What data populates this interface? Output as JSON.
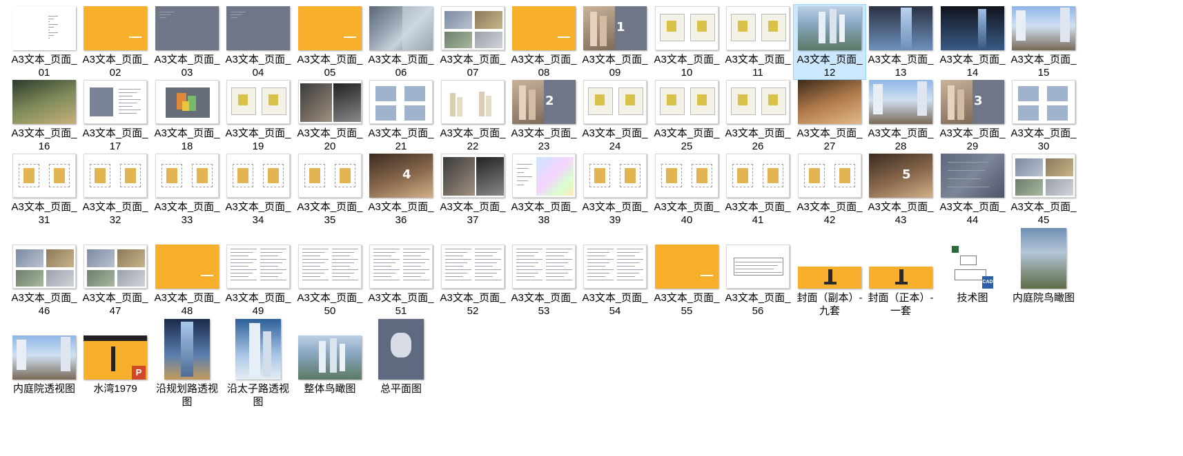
{
  "window": {
    "kind": "file-explorer-large-icons"
  },
  "selected_index": 11,
  "files": [
    {
      "label": "A3文本_页面_01",
      "thumb": "doc-toc"
    },
    {
      "label": "A3文本_页面_02",
      "thumb": "orange"
    },
    {
      "label": "A3文本_页面_03",
      "thumb": "gray-text"
    },
    {
      "label": "A3文本_页面_04",
      "thumb": "gray-text"
    },
    {
      "label": "A3文本_页面_05",
      "thumb": "orange"
    },
    {
      "label": "A3文本_页面_06",
      "thumb": "aerial-map"
    },
    {
      "label": "A3文本_页面_07",
      "thumb": "doc-photos"
    },
    {
      "label": "A3文本_页面_08",
      "thumb": "orange"
    },
    {
      "label": "A3文本_页面_09",
      "thumb": "gray-model"
    },
    {
      "label": "A3文本_页面_10",
      "thumb": "doc-plans"
    },
    {
      "label": "A3文本_页面_11",
      "thumb": "doc-plans"
    },
    {
      "label": "A3文本_页面_12",
      "thumb": "render-aerial"
    },
    {
      "label": "A3文本_页面_13",
      "thumb": "render-tower"
    },
    {
      "label": "A3文本_页面_14",
      "thumb": "render-tower-dark"
    },
    {
      "label": "A3文本_页面_15",
      "thumb": "render-street"
    },
    {
      "label": "A3文本_页面_16",
      "thumb": "render-courtyard"
    },
    {
      "label": "A3文本_页面_17",
      "thumb": "doc-diagram"
    },
    {
      "label": "A3文本_页面_18",
      "thumb": "doc-model3d"
    },
    {
      "label": "A3文本_页面_19",
      "thumb": "doc-plans"
    },
    {
      "label": "A3文本_页面_20",
      "thumb": "doc-massing"
    },
    {
      "label": "A3文本_页面_21",
      "thumb": "doc-elevations"
    },
    {
      "label": "A3文本_页面_22",
      "thumb": "doc-sections"
    },
    {
      "label": "A3文本_页面_23",
      "thumb": "gray-model"
    },
    {
      "label": "A3文本_页面_24",
      "thumb": "doc-plans"
    },
    {
      "label": "A3文本_页面_25",
      "thumb": "doc-plans"
    },
    {
      "label": "A3文本_页面_26",
      "thumb": "doc-plans"
    },
    {
      "label": "A3文本_页面_27",
      "thumb": "render-interior"
    },
    {
      "label": "A3文本_页面_28",
      "thumb": "render-street"
    },
    {
      "label": "A3文本_页面_29",
      "thumb": "gray-model"
    },
    {
      "label": "A3文本_页面_30",
      "thumb": "doc-elevations"
    },
    {
      "label": "A3文本_页面_31",
      "thumb": "doc-floorplan"
    },
    {
      "label": "A3文本_页面_32",
      "thumb": "doc-floorplan"
    },
    {
      "label": "A3文本_页面_33",
      "thumb": "doc-floorplan"
    },
    {
      "label": "A3文本_页面_34",
      "thumb": "doc-floorplan"
    },
    {
      "label": "A3文本_页面_35",
      "thumb": "doc-floorplan"
    },
    {
      "label": "A3文本_页面_36",
      "thumb": "render-model"
    },
    {
      "label": "A3文本_页面_37",
      "thumb": "doc-massing"
    },
    {
      "label": "A3文本_页面_38",
      "thumb": "doc-color-map"
    },
    {
      "label": "A3文本_页面_39",
      "thumb": "doc-floorplan"
    },
    {
      "label": "A3文本_页面_40",
      "thumb": "doc-floorplan"
    },
    {
      "label": "A3文本_页面_41",
      "thumb": "doc-floorplan"
    },
    {
      "label": "A3文本_页面_42",
      "thumb": "doc-floorplan"
    },
    {
      "label": "A3文本_页面_43",
      "thumb": "render-model"
    },
    {
      "label": "A3文本_页面_44",
      "thumb": "gray-map"
    },
    {
      "label": "A3文本_页面_45",
      "thumb": "doc-photos"
    },
    {
      "label": "A3文本_页面_46",
      "thumb": "doc-photos"
    },
    {
      "label": "A3文本_页面_47",
      "thumb": "doc-photos"
    },
    {
      "label": "A3文本_页面_48",
      "thumb": "orange"
    },
    {
      "label": "A3文本_页面_49",
      "thumb": "doc-text"
    },
    {
      "label": "A3文本_页面_50",
      "thumb": "doc-text"
    },
    {
      "label": "A3文本_页面_51",
      "thumb": "doc-text"
    },
    {
      "label": "A3文本_页面_52",
      "thumb": "doc-text"
    },
    {
      "label": "A3文本_页面_53",
      "thumb": "doc-text"
    },
    {
      "label": "A3文本_页面_54",
      "thumb": "doc-text"
    },
    {
      "label": "A3文本_页面_55",
      "thumb": "orange"
    },
    {
      "label": "A3文本_页面_56",
      "thumb": "doc-table"
    },
    {
      "label": "封面（副本）-九套",
      "thumb": "cover"
    },
    {
      "label": "封面（正本）-一套",
      "thumb": "cover"
    },
    {
      "label": "技术图",
      "thumb": "cad"
    },
    {
      "label": "内庭院鸟瞰图",
      "thumb": "tall-courtyard"
    },
    {
      "label": "内庭院透视图",
      "thumb": "render-street"
    },
    {
      "label": "水湾1979",
      "thumb": "ppt"
    },
    {
      "label": "沿规划路透视图",
      "thumb": "tall-tower"
    },
    {
      "label": "沿太子路透视图",
      "thumb": "tall-tower2"
    },
    {
      "label": "整体鸟瞰图",
      "thumb": "render-aerial"
    },
    {
      "label": "总平面图",
      "thumb": "tall-siteplan"
    }
  ],
  "thumb_text": {
    "page09": "1",
    "page23": "2",
    "page29": "3",
    "page36": "4",
    "page43": "5",
    "cad_badge": "CAD",
    "ppt_badge": "P"
  },
  "colors": {
    "orange": "#f8b02c",
    "slate": "#6e7687",
    "selection_bg": "#cce8ff",
    "selection_border": "#99d1ff"
  }
}
